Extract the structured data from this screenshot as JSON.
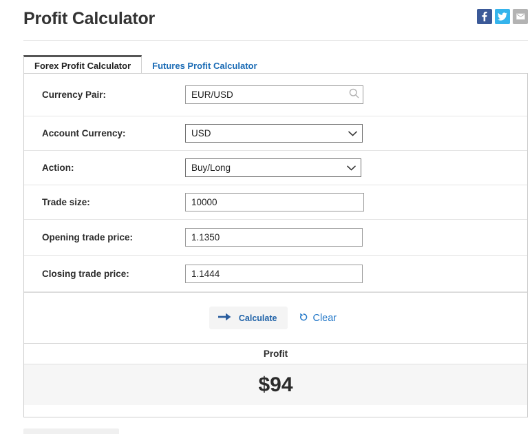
{
  "header": {
    "title": "Profit Calculator",
    "social": [
      {
        "name": "facebook-share-button",
        "glyph": "f",
        "color": "#3b5998"
      },
      {
        "name": "twitter-share-button",
        "glyph": "twitter-bird",
        "color": "#35b4ec"
      },
      {
        "name": "email-share-button",
        "glyph": "envelope",
        "color": "#b3b3b3"
      }
    ]
  },
  "tabs": [
    {
      "label": "Forex Profit Calculator",
      "active": true
    },
    {
      "label": "Futures Profit Calculator",
      "active": false
    }
  ],
  "form": {
    "currency_pair": {
      "label": "Currency Pair:",
      "value": "EUR/USD",
      "placeholder": "EUR/USD",
      "icon": "search-icon"
    },
    "account_currency": {
      "label": "Account Currency:",
      "value": "USD",
      "icon": "chevron-down-icon"
    },
    "action": {
      "label": "Action:",
      "value": "Buy/Long",
      "icon": "chevron-down-icon"
    },
    "trade_size": {
      "label": "Trade size:",
      "value": "10000",
      "placeholder": "10000"
    },
    "opening_price": {
      "label": "Opening trade price:",
      "value": "1.1350",
      "placeholder": "1.1350"
    },
    "closing_price": {
      "label": "Closing trade price:",
      "value": "1.1444",
      "placeholder": "1.1444"
    }
  },
  "actions": {
    "calculate_label": "Calculate",
    "calculate_icon": "arrow-right-icon",
    "clear_label": "Clear",
    "clear_icon": "reset-arrow-icon"
  },
  "result": {
    "header": "Profit",
    "value": "$94"
  },
  "colors": {
    "accent_blue": "#1f62a8",
    "link_blue": "#2277c8",
    "tab_active_border": "#555555",
    "result_bg": "#f6f6f6",
    "text_dark": "#2b2b2b"
  }
}
